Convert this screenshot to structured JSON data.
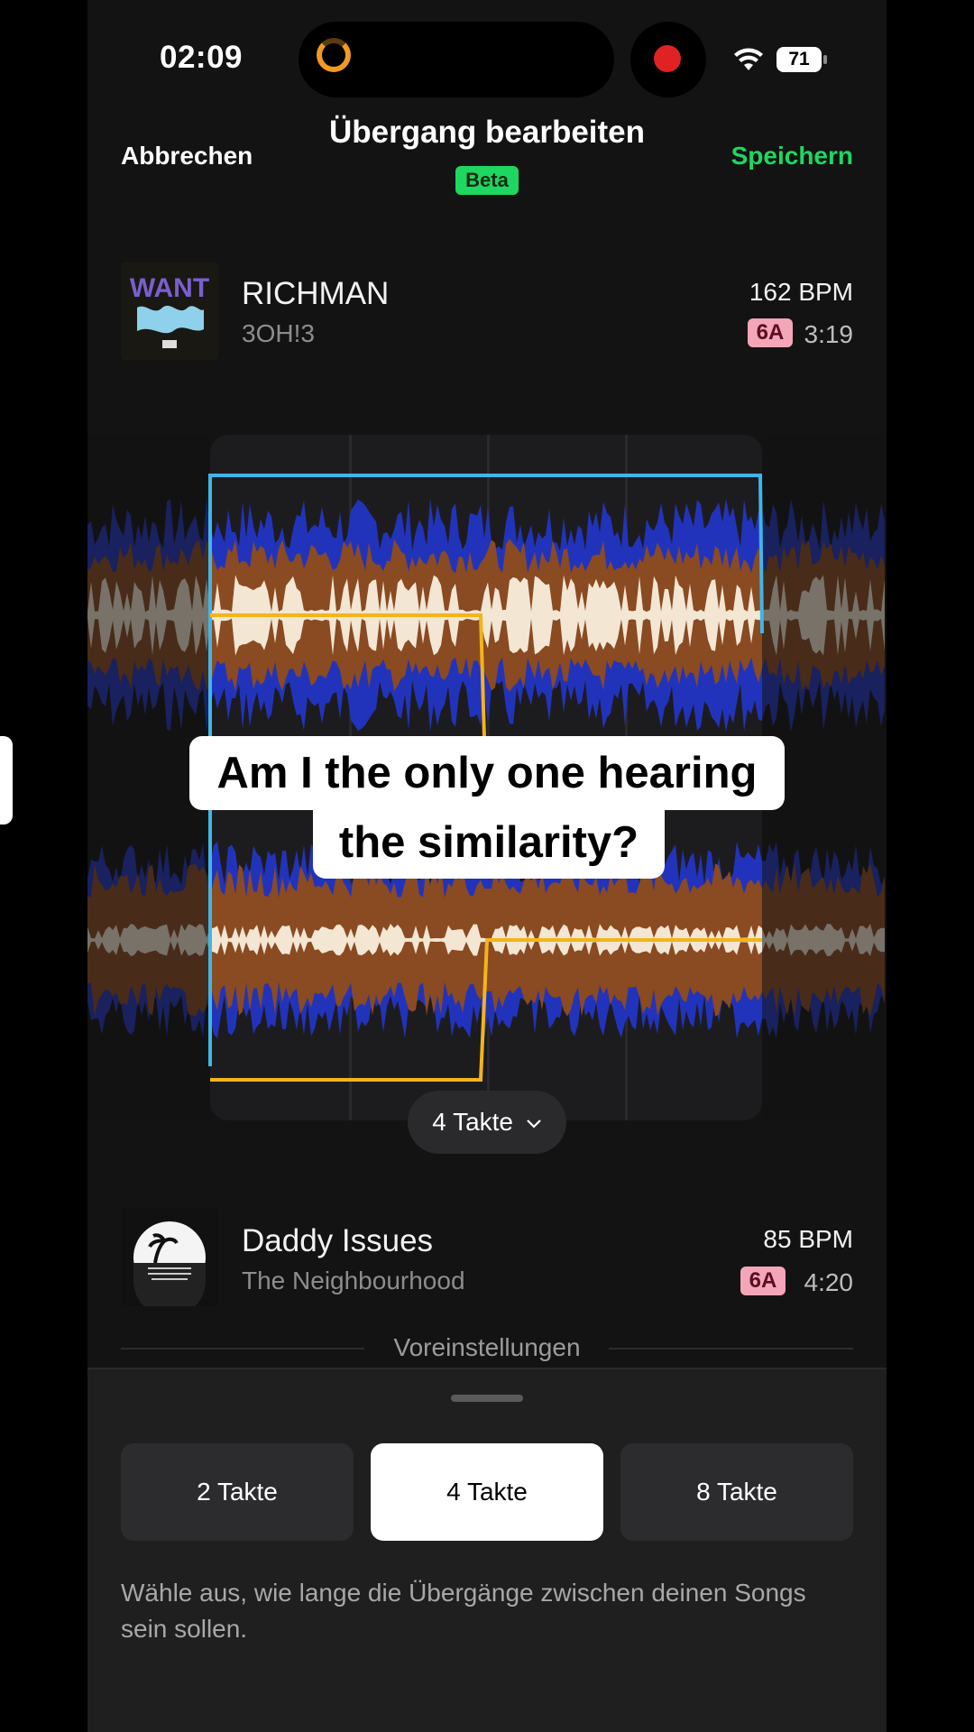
{
  "status_bar": {
    "time": "02:09",
    "battery": "71"
  },
  "header": {
    "cancel_label": "Abbrechen",
    "title": "Übergang bearbeiten",
    "badge": "Beta",
    "save_label": "Speichern"
  },
  "track_top": {
    "title": "RICHMAN",
    "artist": "3OH!3",
    "bpm": "162 BPM",
    "key": "6A",
    "duration": "3:19",
    "cover_text": "WANT"
  },
  "track_bottom": {
    "title": "Daddy Issues",
    "artist": "The Neighbourhood",
    "bpm": "85 BPM",
    "key": "6A",
    "duration": "4:20"
  },
  "caption": {
    "line1": "Am I the only one hearing",
    "line2": "the similarity?"
  },
  "transition": {
    "length_label": "4 Takte"
  },
  "presets": {
    "label": "Voreinstellungen",
    "options": [
      "2 Takte",
      "4 Takte",
      "8 Takte"
    ],
    "selected": "4 Takte",
    "hint": "Wähle aus, wie lange die Übergänge zwischen deinen Songs sein sollen."
  },
  "colors": {
    "accent_green": "#1ed760",
    "selection_blue": "#3fb6e8",
    "crossfade_yellow": "#f4b41a",
    "wave_blue": "#2233bb",
    "wave_brown": "#8a4a22",
    "wave_cream": "#f3e6d3",
    "key_badge": "#f2a6b8"
  }
}
